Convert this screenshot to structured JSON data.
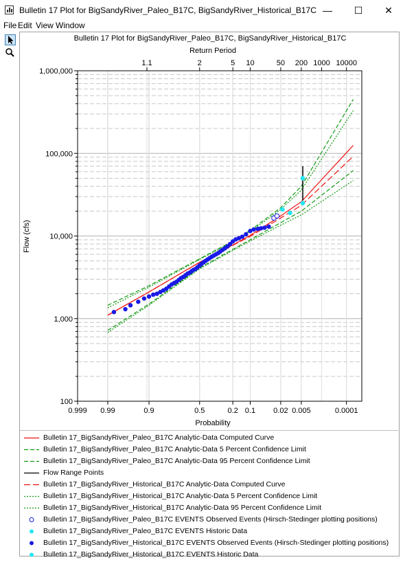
{
  "window": {
    "title": "Bulletin 17 Plot for BigSandyRiver_Paleo_B17C, BigSandyRiver_Historical_B17C",
    "minimize_glyph": "—",
    "maximize_glyph": "☐",
    "close_glyph": "✕"
  },
  "menu": {
    "items": [
      "File",
      "Edit",
      "View",
      "Window"
    ]
  },
  "toolbar": {
    "tools": [
      "pointer-icon",
      "zoom-icon"
    ]
  },
  "colors": {
    "red": "#ee1111",
    "green": "#119911",
    "black": "#000000",
    "blue": "#1a1ae6",
    "cyan": "#22e6f2"
  },
  "chart_data": {
    "type": "scatter",
    "title": "Bulletin 17 Plot for BigSandyRiver_Paleo_B17C, BigSandyRiver_Historical_B17C",
    "top_axis_label": "Return Period",
    "top_ticks": [
      "1.1",
      "2",
      "5",
      "10",
      "50",
      "200",
      "1000",
      "10000"
    ],
    "top_tick_probabilities": [
      0.909,
      0.5,
      0.2,
      0.1,
      0.02,
      0.005,
      0.001,
      0.0001
    ],
    "xlabel": "Probability",
    "x_ticks": [
      "0.999",
      "0.99",
      "0.9",
      "0.5",
      "0.2",
      "0.1",
      "0.02",
      "0.005",
      "0.0001"
    ],
    "x_tick_values": [
      0.999,
      0.99,
      0.9,
      0.5,
      0.2,
      0.1,
      0.02,
      0.005,
      0.0001
    ],
    "x_scale": "normal-probability",
    "x_range": [
      0.999,
      2e-05
    ],
    "ylabel": "Flow (cfs)",
    "y_ticks": [
      "100",
      "1,000",
      "10,000",
      "100,000",
      "1,000,000"
    ],
    "y_tick_values": [
      100,
      1000,
      10000,
      100000,
      1000000
    ],
    "y_scale": "log",
    "ylim": [
      100,
      1000000
    ],
    "grid": true,
    "legend_position": "bottom",
    "series": [
      {
        "name": "Bulletin 17_BigSandyRiver_Paleo_B17C Analytic-Data Computed Curve",
        "style": "solid",
        "color": "red",
        "x": [
          0.99,
          0.9,
          0.5,
          0.2,
          0.1,
          0.02,
          0.005,
          5e-05
        ],
        "y": [
          1100,
          2100,
          4800,
          7800,
          10200,
          17500,
          26000,
          125000
        ]
      },
      {
        "name": "Bulletin 17_BigSandyRiver_Paleo_B17C Analytic-Data 5 Percent Confidence Limit",
        "style": "dashed",
        "color": "green",
        "x": [
          0.99,
          0.9,
          0.5,
          0.2,
          0.1,
          0.02,
          0.005,
          5e-05
        ],
        "y": [
          1450,
          2500,
          5300,
          8700,
          11700,
          22000,
          40000,
          450000
        ]
      },
      {
        "name": "Bulletin 17_BigSandyRiver_Paleo_B17C Analytic-Data 95 Percent Confidence Limit",
        "style": "dashed",
        "color": "green",
        "x": [
          0.99,
          0.9,
          0.5,
          0.2,
          0.1,
          0.02,
          0.005,
          5e-05
        ],
        "y": [
          720,
          1500,
          4100,
          6900,
          9000,
          14500,
          20000,
          62000
        ]
      },
      {
        "name": "Flow Range Points",
        "style": "solid",
        "color": "black",
        "x": [
          0.0045,
          0.0045
        ],
        "y": [
          27000,
          70000
        ]
      },
      {
        "name": "Bulletin 17_BigSandyRiver_Historical_B17C Analytic-Data Computed Curve",
        "style": "longdash",
        "color": "red",
        "x": [
          0.99,
          0.9,
          0.5,
          0.2,
          0.1,
          0.02,
          0.005,
          5e-05
        ],
        "y": [
          1100,
          2100,
          4800,
          7700,
          9900,
          16500,
          23500,
          92000
        ]
      },
      {
        "name": "Bulletin 17_BigSandyRiver_Historical_B17C Analytic-Data 5 Percent Confidence Limit",
        "style": "dotted",
        "color": "green",
        "x": [
          0.99,
          0.9,
          0.5,
          0.2,
          0.1,
          0.02,
          0.005,
          5e-05
        ],
        "y": [
          1350,
          2400,
          5200,
          8500,
          11300,
          21000,
          36000,
          330000
        ]
      },
      {
        "name": "Bulletin 17_BigSandyRiver_Historical_B17C Analytic-Data 95 Percent Confidence Limit",
        "style": "dotted",
        "color": "green",
        "x": [
          0.99,
          0.9,
          0.5,
          0.2,
          0.1,
          0.02,
          0.005,
          5e-05
        ],
        "y": [
          680,
          1450,
          4000,
          6700,
          8700,
          13500,
          18000,
          47000
        ]
      },
      {
        "name": "Bulletin 17_BigSandyRiver_Paleo_B17C EVENTS Observed Events (Hirsch-Stedinger plotting positions)",
        "marker": "open-circle",
        "color": "blue",
        "x": [
          0.03,
          0.025
        ],
        "y": [
          16500,
          17500
        ]
      },
      {
        "name": "Bulletin 17_BigSandyRiver_Paleo_B17C EVENTS Historic Data",
        "marker": "filled-circle",
        "color": "cyan",
        "x": [
          0.0045,
          0.0045,
          0.011,
          0.018
        ],
        "y": [
          50000,
          25000,
          19000,
          21000
        ]
      },
      {
        "name": "Bulletin 17_BigSandyRiver_Historical_B17C EVENTS Observed Events (Hirsch-Stedinger plotting positions)",
        "marker": "filled-circle",
        "color": "blue",
        "x": [
          0.985,
          0.97,
          0.96,
          0.94,
          0.92,
          0.9,
          0.88,
          0.86,
          0.84,
          0.82,
          0.8,
          0.78,
          0.76,
          0.74,
          0.72,
          0.7,
          0.68,
          0.66,
          0.64,
          0.62,
          0.6,
          0.58,
          0.56,
          0.54,
          0.52,
          0.5,
          0.48,
          0.46,
          0.44,
          0.42,
          0.4,
          0.38,
          0.36,
          0.34,
          0.32,
          0.3,
          0.28,
          0.26,
          0.24,
          0.22,
          0.2,
          0.18,
          0.16,
          0.14,
          0.12,
          0.1,
          0.085,
          0.07,
          0.06,
          0.05,
          0.04
        ],
        "y": [
          1200,
          1300,
          1450,
          1600,
          1750,
          1850,
          1950,
          2000,
          2100,
          2200,
          2300,
          2450,
          2600,
          2700,
          2800,
          2950,
          3100,
          3200,
          3350,
          3500,
          3600,
          3750,
          3900,
          4000,
          4200,
          4400,
          4600,
          4800,
          5000,
          5200,
          5400,
          5600,
          5800,
          6000,
          6200,
          6500,
          6800,
          7100,
          7500,
          8000,
          8600,
          9100,
          9400,
          9800,
          10500,
          11500,
          12000,
          12200,
          12400,
          12600,
          13000
        ]
      },
      {
        "name": "Bulletin 17_BigSandyRiver_Historical_B17C EVENTS Historic Data",
        "marker": "filled-circle",
        "color": "cyan",
        "x": [
          0.0045,
          0.0045,
          0.011,
          0.018
        ],
        "y": [
          50000,
          25000,
          19000,
          21000
        ]
      }
    ]
  }
}
